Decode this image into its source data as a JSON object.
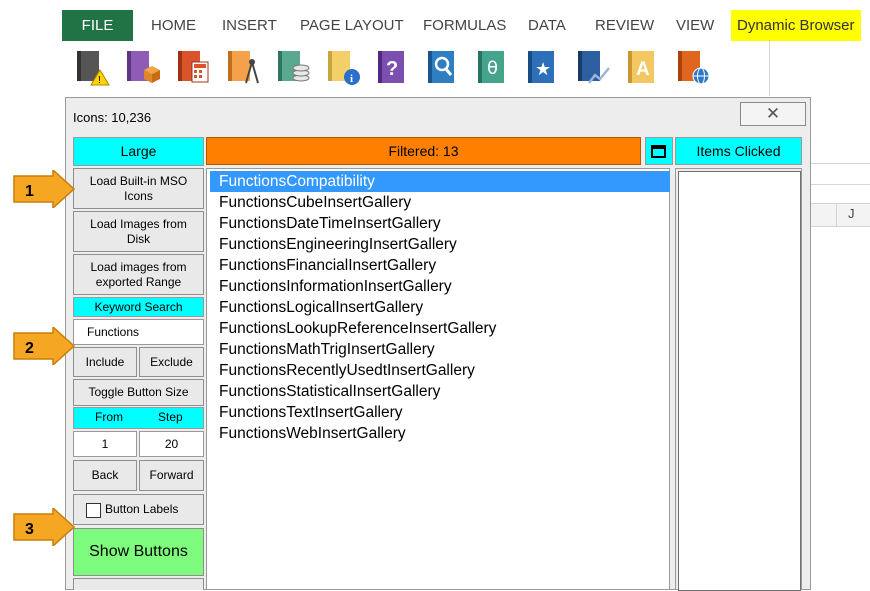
{
  "ribbon": {
    "tabs": [
      "FILE",
      "HOME",
      "INSERT",
      "PAGE LAYOUT",
      "FORMULAS",
      "DATA",
      "REVIEW",
      "VIEW",
      "Dynamic Browser"
    ],
    "icons": [
      "warning-book-icon",
      "box-book-icon",
      "calculator-book-icon",
      "compass-book-icon",
      "coins-book-icon",
      "info-book-icon",
      "question-book-icon",
      "search-book-icon",
      "theta-book-icon",
      "star-book-icon",
      "chart-book-icon",
      "letter-a-book-icon",
      "globe-book-icon"
    ]
  },
  "sheet": {
    "column_label": "J"
  },
  "dialog": {
    "title": "Icons: 10,236",
    "close_glyph": "✕",
    "size_header": "Large",
    "filtered_header": "Filtered: 13",
    "items_clicked_header": "Items Clicked",
    "load_mso_label": "Load Built-in MSO Icons",
    "load_disk_label": "Load Images from Disk",
    "load_range_label": "Load images from exported Range",
    "keyword_header": "Keyword Search",
    "keyword_value": "Functions",
    "include_label": "Include",
    "exclude_label": "Exclude",
    "toggle_label": "Toggle Button Size",
    "from_label": "From",
    "step_label": "Step",
    "from_value": "1",
    "step_value": "20",
    "back_label": "Back",
    "forward_label": "Forward",
    "button_labels_checkbox": "Button Labels",
    "show_buttons_label": "Show Buttons",
    "items": [
      "FunctionsCompatibility",
      "FunctionsCubeInsertGallery",
      "FunctionsDateTimeInsertGallery",
      "FunctionsEngineeringInsertGallery",
      "FunctionsFinancialInsertGallery",
      "FunctionsInformationInsertGallery",
      "FunctionsLogicalInsertGallery",
      "FunctionsLookupReferenceInsertGallery",
      "FunctionsMathTrigInsertGallery",
      "FunctionsRecentlyUsedtInsertGallery",
      "FunctionsStatisticalInsertGallery",
      "FunctionsTextInsertGallery",
      "FunctionsWebInsertGallery"
    ],
    "selected_index": 0
  },
  "callouts": [
    "1",
    "2",
    "3"
  ],
  "colors": {
    "file_tab": "#217346",
    "highlight": "#ffff00",
    "cyan": "#00ffff",
    "orange": "#ff8000",
    "selection": "#3399ff",
    "show_buttons": "#7dfc7d",
    "callout": "#f5a623"
  }
}
